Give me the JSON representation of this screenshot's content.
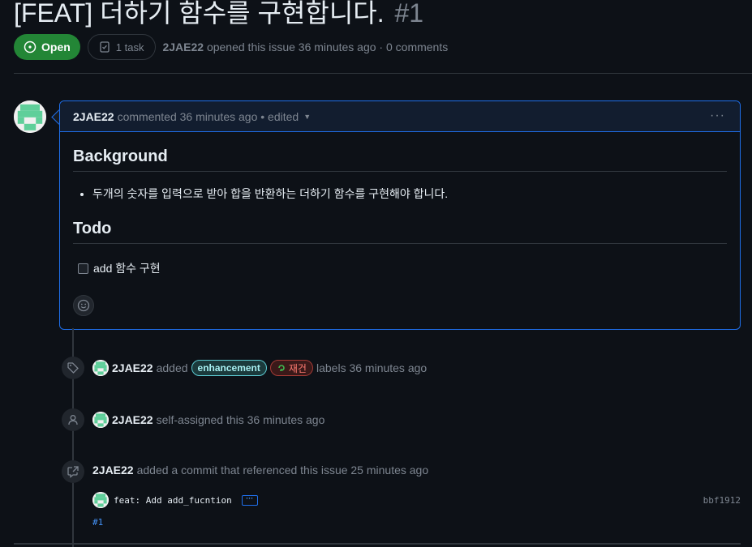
{
  "issue": {
    "title": "[FEAT] 더하기 함수를 구현합니다.",
    "number": "#1",
    "state": "Open",
    "tasks": "1 task",
    "author": "2JAE22",
    "opened_text": "opened this issue 36 minutes ago · 0 comments"
  },
  "comment": {
    "author": "2JAE22",
    "meta": "commented 36 minutes ago • edited",
    "heading_background": "Background",
    "bullet": "두개의 숫자를 입력으로 받아 합을 반환하는 더하기 함수를 구현해야 합니다.",
    "heading_todo": "Todo",
    "task": "add 함수 구현",
    "more_icon": "kebab-horizontal-icon",
    "reaction_icon": "smiley-icon"
  },
  "timeline": {
    "labels_event": {
      "icon": "tag-icon",
      "author": "2JAE22",
      "verb": "added",
      "label1": "enhancement",
      "label2": "재건",
      "suffix": "labels 36 minutes ago"
    },
    "assign_event": {
      "icon": "person-icon",
      "author": "2JAE22",
      "text": "self-assigned this 36 minutes ago"
    },
    "commit_event": {
      "icon": "cross-reference-icon",
      "author": "2JAE22",
      "text": "added a commit that referenced this issue 25 minutes ago",
      "commit_message": "feat: Add add_fucntion",
      "sha": "bbf1912",
      "ref": "#1"
    }
  },
  "colors": {
    "open_green": "#238636",
    "accent_blue": "#1f6feb",
    "enhancement_label": "#a8f0f2",
    "rebuild_label": "#ff7b72"
  }
}
